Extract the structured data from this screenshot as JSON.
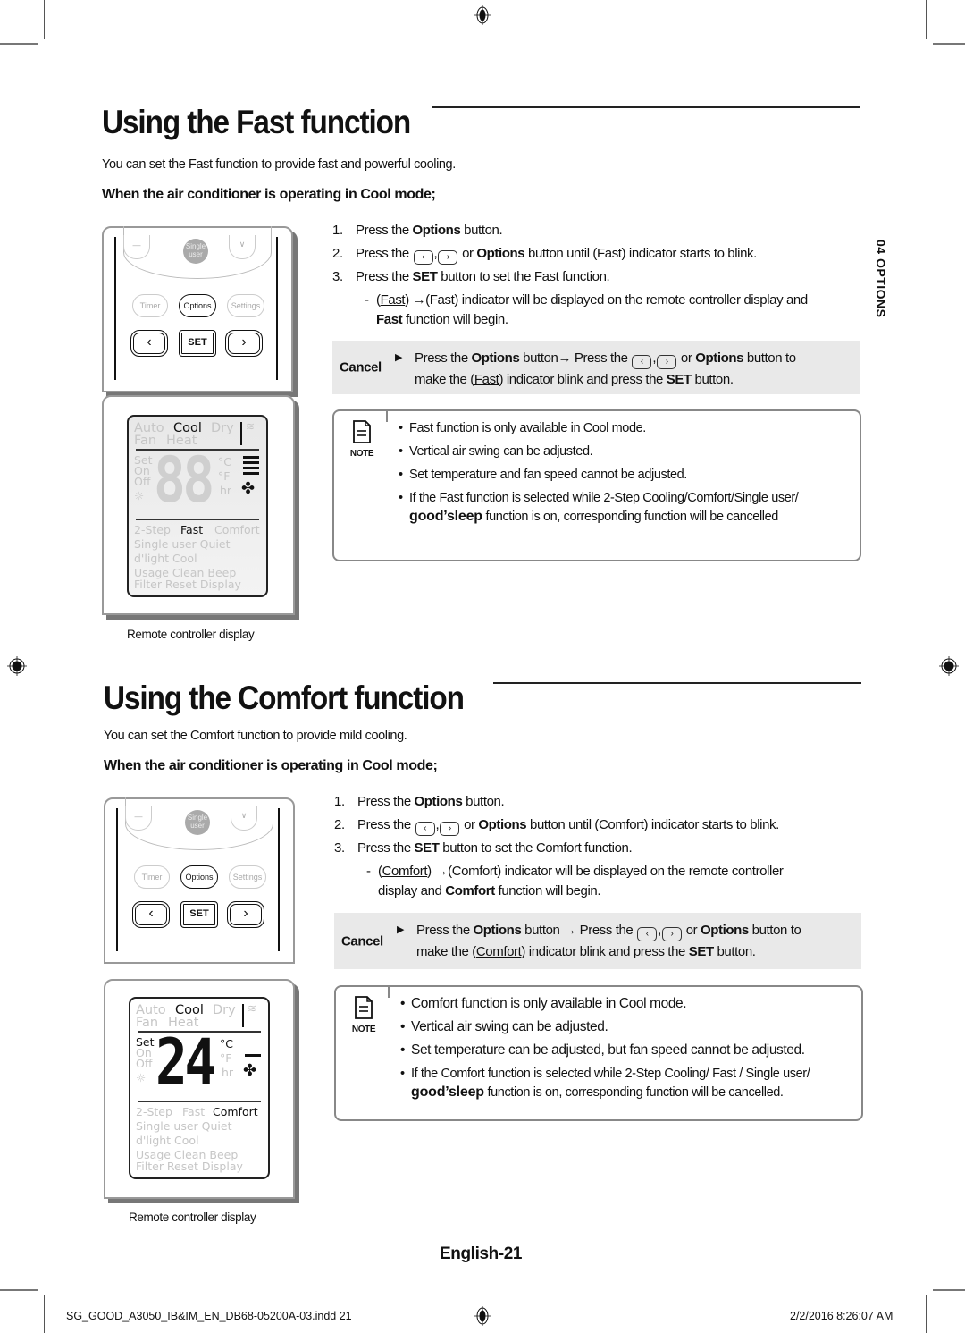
{
  "side_tab": "04  OPTIONS",
  "sections": [
    {
      "title": "Using the Fast function",
      "intro": "You can set the Fast function to provide fast and powerful cooling.",
      "subheading": "When the air conditioner is operating in Cool mode;",
      "steps": [
        {
          "num": "1.",
          "pre": "Press the ",
          "bold": "Options",
          "post": " button."
        },
        {
          "num": "2.",
          "pre": "Press the ",
          "mid": " or ",
          "bold": "Options",
          "post": " button until (Fast) indicator starts to blink."
        },
        {
          "num": "3.",
          "pre": "Press the ",
          "bold": "SET",
          "post": " button to set the Fast function."
        }
      ],
      "substep": {
        "indicator": "Fast",
        "line1": " →(Fast) indicator will be displayed on the remote controller display and",
        "line2_bold": "Fast",
        "line2": " function will begin."
      },
      "cancel": {
        "label": "Cancel",
        "line1_pre": "Press the ",
        "line1_bold1": "Options",
        "line1_mid": " button→ Press the ",
        "line1_or": " or ",
        "line1_bold2": "Options",
        "line1_post": " button to",
        "line2_pre": "make the (",
        "line2_ind": "Fast",
        "line2_mid": ") indicator blink and press the ",
        "line2_bold": "SET",
        "line2_post": " button."
      },
      "note": {
        "label": "NOTE",
        "items": [
          "Fast function is only available in Cool mode.",
          "Vertical air swing can be adjusted.",
          "Set temperature and fan speed cannot be adjusted.",
          "If  the Fast function is selected while 2-Step Cooling/Comfort/Single user/"
        ],
        "last_cont_brand": "good’sleep",
        "last_cont": " function is on, corresponding function will be cancelled"
      },
      "remote": {
        "buttons": {
          "single_user": "Single user",
          "timer": "Timer",
          "options": "Options",
          "settings": "Settings",
          "set": "SET",
          "left": "‹",
          "right": "›"
        },
        "display": {
          "temp": "88",
          "modes_row1": [
            "Auto",
            "Cool",
            "Dry"
          ],
          "modes_row2": [
            "Fan",
            "Heat"
          ],
          "active_mode": "Cool",
          "units": [
            "°C",
            "°F",
            "hr"
          ],
          "left_labels": [
            "Set",
            "On",
            "Off"
          ],
          "functions": [
            "2-Step",
            "Fast",
            "Comfort"
          ],
          "active_function": "Fast",
          "row_single": "Single user Quiet",
          "row_dlight": "d'light Cool",
          "row_usage": "Usage   Clean   Beep",
          "row_filter": "Filter Reset  Display"
        },
        "caption": "Remote controller display"
      }
    },
    {
      "title": "Using the Comfort function",
      "intro": "You can set the Comfort function to provide mild cooling.",
      "subheading": "When the air conditioner is operating in Cool mode;",
      "steps": [
        {
          "num": "1.",
          "pre": "Press the ",
          "bold": "Options",
          "post": " button."
        },
        {
          "num": "2.",
          "pre": "Press the ",
          "mid": " or ",
          "bold": "Options",
          "post": " button until (Comfort) indicator starts to blink."
        },
        {
          "num": "3.",
          "pre": "Press the ",
          "bold": "SET",
          "post": " button to set the Comfort function."
        }
      ],
      "substep": {
        "indicator": "Comfort",
        "line1": " →(Comfort) indicator will be displayed on the remote controller",
        "line2_pre": "display and ",
        "line2_bold": "Comfort",
        "line2": " function will begin."
      },
      "cancel": {
        "label": "Cancel",
        "line1_pre": "Press the ",
        "line1_bold1": "Options",
        "line1_mid": " button → Press the ",
        "line1_or": " or ",
        "line1_bold2": "Options",
        "line1_post": " button to",
        "line2_pre": "make the (",
        "line2_ind": "Comfort",
        "line2_mid": ") indicator blink and press the ",
        "line2_bold": "SET",
        "line2_post": " button."
      },
      "note": {
        "label": "NOTE",
        "items": [
          "Comfort function is only available in Cool mode.",
          "Vertical air swing can be adjusted.",
          "Set temperature can be adjusted, but fan speed cannot be adjusted.",
          "If the Comfort function is selected while 2-Step Cooling/ Fast / Single user/"
        ],
        "last_cont_brand": "good’sleep",
        "last_cont": " function is on, corresponding function will be cancelled."
      },
      "remote": {
        "buttons": {
          "single_user": "Single user",
          "timer": "Timer",
          "options": "Options",
          "settings": "Settings",
          "set": "SET",
          "left": "‹",
          "right": "›"
        },
        "display": {
          "temp": "24",
          "modes_row1": [
            "Auto",
            "Cool",
            "Dry"
          ],
          "modes_row2": [
            "Fan",
            "Heat"
          ],
          "active_mode": "Cool",
          "units": [
            "°C",
            "°F",
            "hr"
          ],
          "left_labels": [
            "Set",
            "On",
            "Off"
          ],
          "functions": [
            "2-Step",
            "Fast",
            "Comfort"
          ],
          "active_function": "Comfort",
          "row_single": "Single user Quiet",
          "row_dlight": "d'light Cool",
          "row_usage": "Usage   Clean   Beep",
          "row_filter": "Filter Reset  Display"
        },
        "caption": "Remote controller display"
      }
    }
  ],
  "footer": {
    "page_label": "English-21",
    "slug_file": "SG_GOOD_A3050_IB&IM_EN_DB68-05200A-03.indd   21",
    "slug_date": "2/2/2016   8:26:07 AM"
  }
}
